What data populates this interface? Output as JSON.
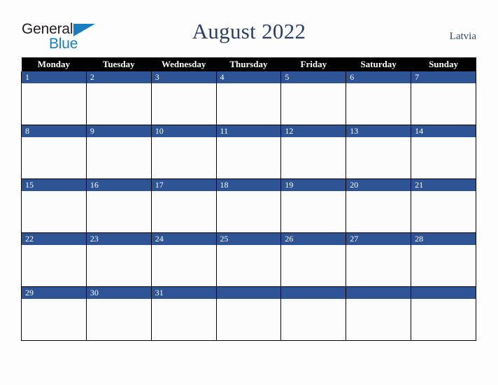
{
  "brand": {
    "line1": "General",
    "line2": "Blue",
    "triangle_icon": "blue-triangle-icon",
    "color_dark": "#231f20",
    "color_blue": "#1b7ec2"
  },
  "header": {
    "title": "August 2022",
    "country": "Latvia",
    "title_color": "#2b3f6b"
  },
  "calendar": {
    "weekday_headers": [
      "Monday",
      "Tuesday",
      "Wednesday",
      "Thursday",
      "Friday",
      "Saturday",
      "Sunday"
    ],
    "header_bg": "#010101",
    "header_fg": "#ffffff",
    "daynum_bg": "#2f5496",
    "daynum_fg": "#ffffff",
    "cell_bg": "#fcfcfd",
    "border_color": "#000000",
    "weeks": [
      [
        "1",
        "2",
        "3",
        "4",
        "5",
        "6",
        "7"
      ],
      [
        "8",
        "9",
        "10",
        "11",
        "12",
        "13",
        "14"
      ],
      [
        "15",
        "16",
        "17",
        "18",
        "19",
        "20",
        "21"
      ],
      [
        "22",
        "23",
        "24",
        "25",
        "26",
        "27",
        "28"
      ],
      [
        "29",
        "30",
        "31",
        "",
        "",
        "",
        ""
      ]
    ]
  }
}
